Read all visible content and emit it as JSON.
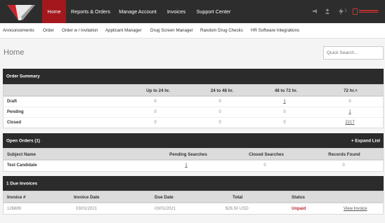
{
  "nav": {
    "items": [
      {
        "label": "Home",
        "active": true
      },
      {
        "label": "Reports & Orders",
        "active": false
      },
      {
        "label": "Manage Account",
        "active": false
      },
      {
        "label": "Invoices",
        "active": false
      },
      {
        "label": "Support Center",
        "active": false
      }
    ],
    "notifications_count": "1",
    "colors": {
      "bar": "#2d2d2d",
      "active": "#a4171d",
      "accent": "#d23030"
    }
  },
  "subnav": {
    "items": [
      "Announcements",
      "Order",
      "Order w / invitation",
      "Applicant Manager",
      "Drug Screen Manager",
      "Random Drug Checks",
      "HR Software Integrations"
    ]
  },
  "page": {
    "title": "Home"
  },
  "search": {
    "placeholder": "Quick Search..."
  },
  "order_summary": {
    "title": "Order Summary",
    "columns": [
      "",
      "Up to 24 hr.",
      "24 to 48 hr.",
      "48 to 72 hr.",
      "72 hr.+"
    ],
    "rows": [
      {
        "label": "Draft",
        "values": [
          "0",
          "0",
          "1",
          "0"
        ]
      },
      {
        "label": "Pending",
        "values": [
          "0",
          "0",
          "0",
          "1"
        ]
      },
      {
        "label": "Closed",
        "values": [
          "0",
          "0",
          "0",
          "2217"
        ]
      }
    ]
  },
  "open_orders": {
    "title": "Open Orders (1)",
    "expand_label": "+ Expand List",
    "columns": [
      "Subject Name",
      "Pending Searches",
      "Closed Searches",
      "Records Found"
    ],
    "rows": [
      {
        "subject": "Test Candidate",
        "pending": "1",
        "closed": "0",
        "records": "0"
      }
    ]
  },
  "invoices": {
    "title": "1 Due Invoices",
    "columns": [
      "Invoice #",
      "Invoice Date",
      "Due Date",
      "Total",
      "Status"
    ],
    "rows": [
      {
        "number": "126889",
        "invoice_date": "03/01/2021",
        "due_date": "03/01/2021",
        "total": "$26.50 USD",
        "status": "Unpaid",
        "action": "View Invoice"
      }
    ]
  }
}
